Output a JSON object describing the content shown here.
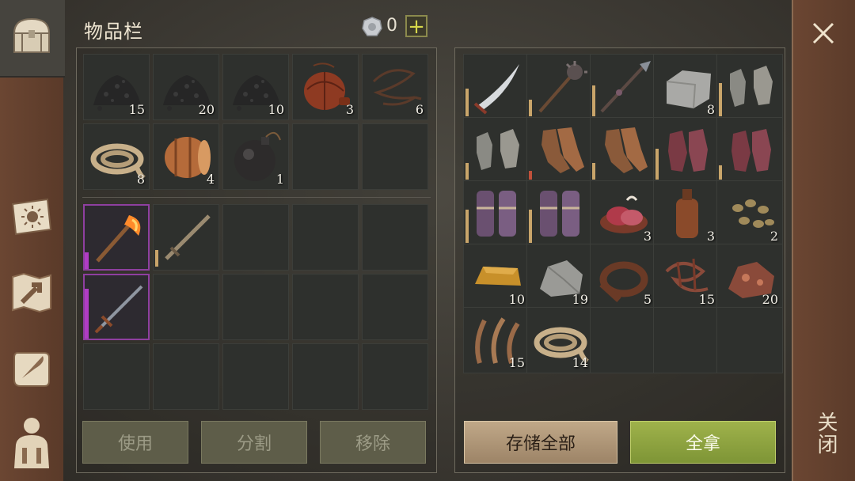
{
  "header": {
    "title": "物品栏",
    "coins": "0",
    "add_label": "+"
  },
  "close_label": "关闭",
  "nav": [
    {
      "name": "chest-icon"
    },
    {
      "name": "sun-book-icon"
    },
    {
      "name": "craft-map-icon"
    },
    {
      "name": "scroll-quill-icon"
    },
    {
      "name": "character-icon"
    }
  ],
  "inventory": {
    "resources": [
      {
        "icon": "charcoal-icon",
        "count": "15"
      },
      {
        "icon": "charcoal-icon",
        "count": "20"
      },
      {
        "icon": "charcoal-icon",
        "count": "10"
      },
      {
        "icon": "leather-flask-icon",
        "count": "3"
      },
      {
        "icon": "rope-icon",
        "count": "6"
      },
      {
        "icon": "coiled-rope-icon",
        "count": "8"
      },
      {
        "icon": "barrel-icon",
        "count": "4"
      },
      {
        "icon": "bomb-icon",
        "count": "1"
      },
      {
        "icon": "",
        "count": ""
      },
      {
        "icon": "",
        "count": ""
      }
    ],
    "equipment": [
      {
        "icon": "fire-axe-icon",
        "count": "",
        "selected": true,
        "durability": 0.3
      },
      {
        "icon": "sword-icon",
        "count": "",
        "selected": false,
        "durability": 0.3
      },
      {
        "icon": "",
        "count": ""
      },
      {
        "icon": "",
        "count": ""
      },
      {
        "icon": "",
        "count": ""
      },
      {
        "icon": "longsword-icon",
        "count": "",
        "selected": true,
        "durability": 0.9
      },
      {
        "icon": "",
        "count": ""
      },
      {
        "icon": "",
        "count": ""
      },
      {
        "icon": "",
        "count": ""
      },
      {
        "icon": "",
        "count": ""
      },
      {
        "icon": "",
        "count": ""
      },
      {
        "icon": "",
        "count": ""
      },
      {
        "icon": "",
        "count": ""
      },
      {
        "icon": "",
        "count": ""
      },
      {
        "icon": "",
        "count": ""
      }
    ],
    "buttons": {
      "use": "使用",
      "split": "分割",
      "remove": "移除"
    }
  },
  "storage": {
    "items": [
      {
        "icon": "scimitar-icon",
        "count": "",
        "durability": 0.5
      },
      {
        "icon": "mace-icon",
        "count": "",
        "durability": 0.3
      },
      {
        "icon": "spear-icon",
        "count": "",
        "durability": 0.55
      },
      {
        "icon": "stone-block-icon",
        "count": "8"
      },
      {
        "icon": "gloves-icon",
        "count": "",
        "durability": 0.6
      },
      {
        "icon": "gloves-icon",
        "count": "",
        "durability": 0.3
      },
      {
        "icon": "leather-gloves-icon",
        "count": "",
        "durability": 0.15,
        "low": true
      },
      {
        "icon": "leather-gloves-icon",
        "count": "",
        "durability": 0.3
      },
      {
        "icon": "chainmail-gloves-icon",
        "count": "",
        "durability": 0.55
      },
      {
        "icon": "chainmail-gloves-icon",
        "count": "",
        "durability": 0.25
      },
      {
        "icon": "bracers-icon",
        "count": "",
        "durability": 0.6
      },
      {
        "icon": "bracers-icon",
        "count": "",
        "durability": 0.6
      },
      {
        "icon": "raw-meat-icon",
        "count": "3"
      },
      {
        "icon": "bottle-icon",
        "count": "3"
      },
      {
        "icon": "seeds-icon",
        "count": "2"
      },
      {
        "icon": "gold-ingot-icon",
        "count": "10"
      },
      {
        "icon": "stone-icon",
        "count": "19"
      },
      {
        "icon": "leather-roll-icon",
        "count": "5"
      },
      {
        "icon": "sinew-icon",
        "count": "15"
      },
      {
        "icon": "copper-ore-icon",
        "count": "20"
      },
      {
        "icon": "fiber-icon",
        "count": "15"
      },
      {
        "icon": "coiled-rope-icon",
        "count": "14"
      },
      {
        "icon": "",
        "count": ""
      },
      {
        "icon": "",
        "count": ""
      },
      {
        "icon": "",
        "count": ""
      }
    ],
    "buttons": {
      "store_all": "存储全部",
      "take_all": "全拿"
    }
  }
}
